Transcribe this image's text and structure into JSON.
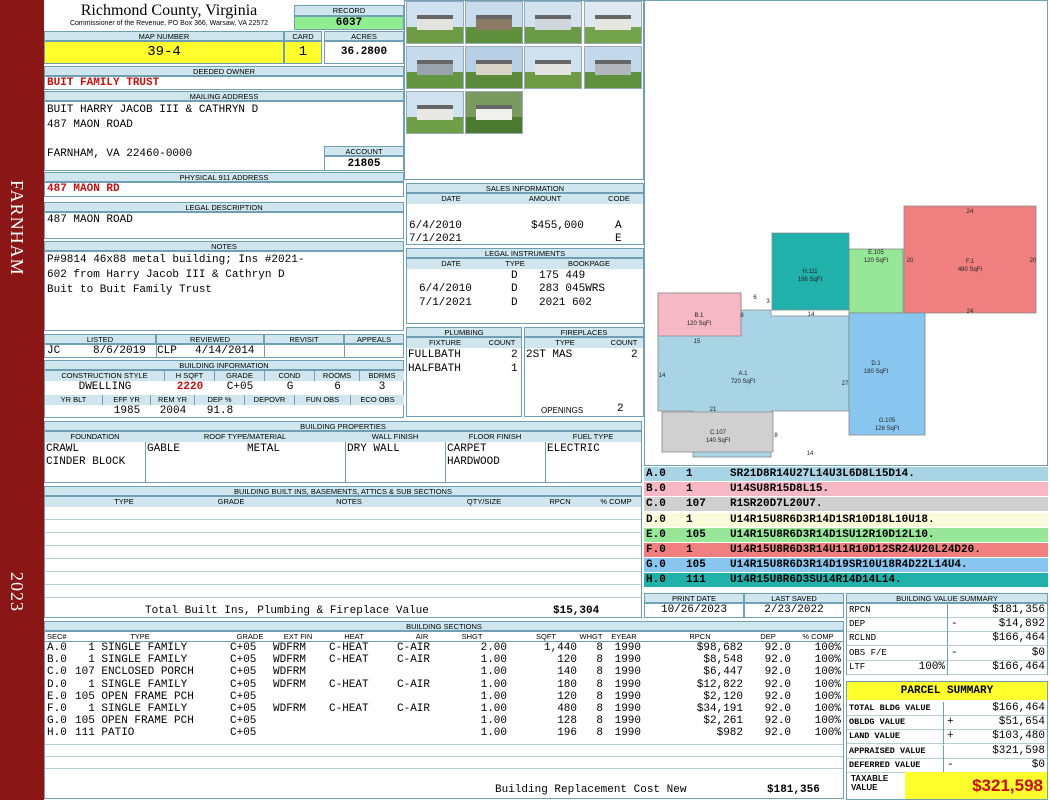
{
  "sidebar": {
    "town": "FARNHAM",
    "year": "2023"
  },
  "county": {
    "title": "Richmond County, Virginia",
    "subtitle": "Commissioner of the Revenue, PO Box 366, Warsaw, VA 22572"
  },
  "record": {
    "label": "RECORD",
    "value": "6037"
  },
  "map": {
    "label": "MAP NUMBER",
    "value": "39-4",
    "card_label": "CARD",
    "card": "1",
    "acres_label": "ACRES",
    "acres": "36.2800"
  },
  "owner": {
    "label": "DEEDED OWNER",
    "value": "BUIT FAMILY TRUST"
  },
  "mailing": {
    "label": "MAILING ADDRESS",
    "line1": "BUIT HARRY JACOB III & CATHRYN D",
    "line2": "487 MAON ROAD",
    "line3": "FARNHAM, VA 22460-0000"
  },
  "account": {
    "label": "ACCOUNT",
    "value": "21805"
  },
  "physical": {
    "label": "PHYSICAL 911 ADDRESS",
    "value": "487 MAON RD"
  },
  "legal": {
    "label": "LEGAL DESCRIPTION",
    "value": "487 MAON ROAD"
  },
  "notes": {
    "label": "NOTES",
    "line1": "P#9814 46x88 metal building; Ins #2021-",
    "line2": "602 from Harry Jacob III & Cathryn D",
    "line3": "Buit to Buit Family Trust"
  },
  "review": {
    "listed_label": "LISTED",
    "listed_by": "JC",
    "listed_date": "8/6/2019",
    "reviewed_label": "REVIEWED",
    "reviewed_by": "CLP",
    "reviewed_date": "4/14/2014",
    "revisit_label": "REVISIT",
    "appeals_label": "APPEALS"
  },
  "building_info": {
    "label": "BUILDING INFORMATION",
    "h1": "CONSTRUCTION STYLE",
    "h2": "H SQFT",
    "h3": "GRADE",
    "h4": "COND",
    "h5": "ROOMS",
    "h6": "BDRMS",
    "style": "DWELLING",
    "sqft": "2220",
    "grade": "C+05",
    "cond": "G",
    "rooms": "6",
    "bdrms": "3",
    "h7": "YR BLT",
    "h8": "EFF YR",
    "h9": "REM YR",
    "h10": "DEP %",
    "h11": "DEPOVR",
    "h12": "FUN OBS",
    "h13": "ECO OBS",
    "eff_yr": "1985",
    "rem_yr": "2004",
    "dep": "91.8"
  },
  "sales": {
    "label": "SALES INFORMATION",
    "h_date": "DATE",
    "h_amount": "AMOUNT",
    "h_code": "CODE",
    "rows": [
      {
        "date": "6/4/2010",
        "amount": "$455,000",
        "code": "A"
      },
      {
        "date": "7/1/2021",
        "amount": "",
        "code": "E"
      }
    ]
  },
  "legal_instruments": {
    "label": "LEGAL INSTRUMENTS",
    "h_date": "DATE",
    "h_type": "TYPE",
    "h_book": "BOOKPAGE",
    "rows": [
      {
        "date": "",
        "type": "D",
        "book": "175 449"
      },
      {
        "date": "6/4/2010",
        "type": "D",
        "book": "283 045WRS"
      },
      {
        "date": "7/1/2021",
        "type": "D",
        "book": "2021 602"
      }
    ]
  },
  "plumbing": {
    "label": "PLUMBING",
    "h_fixture": "FIXTURE",
    "h_count": "COUNT",
    "rows": [
      {
        "fixture": "FULLBATH",
        "count": "2"
      },
      {
        "fixture": "HALFBATH",
        "count": "1"
      }
    ]
  },
  "fireplaces": {
    "label": "FIREPLACES",
    "h_type": "TYPE",
    "h_count": "COUNT",
    "rows": [
      {
        "type": "2ST MAS",
        "count": "2"
      }
    ],
    "openings_label": "OPENINGS",
    "openings": "2"
  },
  "properties": {
    "label": "BUILDING PROPERTIES",
    "h_found": "FOUNDATION",
    "h_roof": "ROOF TYPE/MATERIAL",
    "h_wall": "WALL FINISH",
    "h_floor": "FLOOR FINISH",
    "h_fuel": "FUEL TYPE",
    "found1": "CRAWL",
    "found2": "CINDER BLOCK",
    "roof_type": "GABLE",
    "roof_mat": "METAL",
    "wall": "DRY WALL",
    "floor1": "CARPET",
    "floor2": "HARDWOOD",
    "fuel": "ELECTRIC"
  },
  "builtins": {
    "label": "BUILDING BUILT INS, BASEMENTS, ATTICS & SUB SECTIONS",
    "h_type": "TYPE",
    "h_grade": "GRADE",
    "h_notes": "NOTES",
    "h_qty": "QTY/SIZE",
    "h_rpcn": "RPCN",
    "h_comp": "% COMP",
    "total_label": "Total Built Ins, Plumbing & Fireplace Value",
    "total": "$15,304"
  },
  "dates": {
    "print_label": "PRINT DATE",
    "print": "10/26/2023",
    "saved_label": "LAST SAVED",
    "saved": "2/23/2022"
  },
  "sections": {
    "label": "BUILDING SECTIONS",
    "headers": [
      "SEC#",
      "TYPE",
      "GRADE",
      "EXT FIN",
      "HEAT",
      "AIR",
      "SHGT",
      "SQFT",
      "WHGT",
      "EYEAR",
      "RPCN",
      "DEP",
      "% COMP"
    ],
    "rows": [
      {
        "sec": "A.0",
        "num": "1",
        "type": "SINGLE FAMILY",
        "grade": "C+05",
        "ext": "WDFRM",
        "heat": "C-HEAT",
        "air": "C-AIR",
        "shgt": "2.00",
        "sqft": "1,440",
        "whgt": "8",
        "eyear": "1990",
        "rpcn": "$98,682",
        "dep": "92.0",
        "comp": "100%"
      },
      {
        "sec": "B.0",
        "num": "1",
        "type": "SINGLE FAMILY",
        "grade": "C+05",
        "ext": "WDFRM",
        "heat": "C-HEAT",
        "air": "C-AIR",
        "shgt": "1.00",
        "sqft": "120",
        "whgt": "8",
        "eyear": "1990",
        "rpcn": "$8,548",
        "dep": "92.0",
        "comp": "100%"
      },
      {
        "sec": "C.0",
        "num": "107",
        "type": "ENCLOSED PORCH",
        "grade": "C+05",
        "ext": "WDFRM",
        "heat": "",
        "air": "",
        "shgt": "1.00",
        "sqft": "140",
        "whgt": "8",
        "eyear": "1990",
        "rpcn": "$6,447",
        "dep": "92.0",
        "comp": "100%"
      },
      {
        "sec": "D.0",
        "num": "1",
        "type": "SINGLE FAMILY",
        "grade": "C+05",
        "ext": "WDFRM",
        "heat": "C-HEAT",
        "air": "C-AIR",
        "shgt": "1.00",
        "sqft": "180",
        "whgt": "8",
        "eyear": "1990",
        "rpcn": "$12,822",
        "dep": "92.0",
        "comp": "100%"
      },
      {
        "sec": "E.0",
        "num": "105",
        "type": "OPEN FRAME PCH",
        "grade": "C+05",
        "ext": "",
        "heat": "",
        "air": "",
        "shgt": "1.00",
        "sqft": "120",
        "whgt": "8",
        "eyear": "1990",
        "rpcn": "$2,120",
        "dep": "92.0",
        "comp": "100%"
      },
      {
        "sec": "F.0",
        "num": "1",
        "type": "SINGLE FAMILY",
        "grade": "C+05",
        "ext": "WDFRM",
        "heat": "C-HEAT",
        "air": "C-AIR",
        "shgt": "1.00",
        "sqft": "480",
        "whgt": "8",
        "eyear": "1990",
        "rpcn": "$34,191",
        "dep": "92.0",
        "comp": "100%"
      },
      {
        "sec": "G.0",
        "num": "105",
        "type": "OPEN FRAME PCH",
        "grade": "C+05",
        "ext": "",
        "heat": "",
        "air": "",
        "shgt": "1.00",
        "sqft": "128",
        "whgt": "8",
        "eyear": "1990",
        "rpcn": "$2,261",
        "dep": "92.0",
        "comp": "100%"
      },
      {
        "sec": "H.0",
        "num": "111",
        "type": "PATIO",
        "grade": "C+05",
        "ext": "",
        "heat": "",
        "air": "",
        "shgt": "1.00",
        "sqft": "196",
        "whgt": "8",
        "eyear": "1990",
        "rpcn": "$982",
        "dep": "92.0",
        "comp": "100%"
      }
    ],
    "total_label": "Building Replacement Cost New",
    "total": "$181,356"
  },
  "sketch": {
    "labels": [
      {
        "id": "A.1",
        "area": "720 SqFt",
        "color": "#a8d4e6"
      },
      {
        "id": "B.1",
        "area": "120 SqFt",
        "color": "#f5b8c4"
      },
      {
        "id": "C.107",
        "area": "140 SqFt",
        "color": "#d0d0d0"
      },
      {
        "id": "D.1",
        "area": "180 SqFt",
        "color": "#fbfbdc"
      },
      {
        "id": "E.105",
        "area": "120 SqFt",
        "color": "#98e698"
      },
      {
        "id": "F.1",
        "area": "480 SqFt",
        "color": "#f08080"
      },
      {
        "id": "G.105",
        "area": "128 SqFt",
        "color": "#88c6f0"
      },
      {
        "id": "H.111",
        "area": "196 SqFt",
        "color": "#20b2aa"
      }
    ],
    "dims": [
      "24",
      "20",
      "20",
      "24",
      "6",
      "3",
      "8",
      "14",
      "15",
      "14",
      "27",
      "21",
      "8",
      "14"
    ]
  },
  "traverse": [
    {
      "sec": "A.0",
      "num": "1",
      "code": "SR21D8R14U27L14U3L6D8L15D14.",
      "color": "#a8d4e6"
    },
    {
      "sec": "B.0",
      "num": "1",
      "code": "U14SU8R15D8L15.",
      "color": "#f5b8c4"
    },
    {
      "sec": "C.0",
      "num": "107",
      "code": "R1SR20D7L20U7.",
      "color": "#d0d0d0"
    },
    {
      "sec": "D.0",
      "num": "1",
      "code": "U14R15U8R6D3R14D1SR10D18L10U18.",
      "color": "#fbfbdc"
    },
    {
      "sec": "E.0",
      "num": "105",
      "code": "U14R15U8R6D3R14D1SU12R10D12L10.",
      "color": "#98e698"
    },
    {
      "sec": "F.0",
      "num": "1",
      "code": "U14R15U8R6D3R14U11R10D12SR24U20L24D20.",
      "color": "#f08080"
    },
    {
      "sec": "G.0",
      "num": "105",
      "code": "U14R15U8R6D3R14D19SR10U18R4D22L14U4.",
      "color": "#88c6f0"
    },
    {
      "sec": "H.0",
      "num": "111",
      "code": "U14R15U8R6D3SU14R14D14L14.",
      "color": "#20b2aa"
    }
  ],
  "value_summary": {
    "label": "BUILDING VALUE SUMMARY",
    "rows": [
      {
        "label": "RPCN",
        "sign": "",
        "pct": "",
        "value": "$181,356"
      },
      {
        "label": "DEP",
        "sign": "-",
        "pct": "",
        "value": "$14,892"
      },
      {
        "label": "RCLND",
        "sign": "",
        "pct": "",
        "value": "$166,464"
      },
      {
        "label": "OBS F/E",
        "sign": "-",
        "pct": "",
        "value": "$0"
      },
      {
        "label": "LTF",
        "sign": "",
        "pct": "100%",
        "value": "$166,464"
      }
    ]
  },
  "parcel": {
    "label": "PARCEL SUMMARY",
    "rows": [
      {
        "label": "TOTAL BLDG VALUE",
        "sign": "",
        "value": "$166,464"
      },
      {
        "label": "OBLDG VALUE",
        "sign": "+",
        "value": "$51,654"
      },
      {
        "label": "LAND VALUE",
        "sign": "+",
        "value": "$103,480"
      },
      {
        "label": "APPRAISED VALUE",
        "sign": "",
        "value": "$321,598"
      },
      {
        "label": "DEFERRED VALUE",
        "sign": "-",
        "value": "$0"
      }
    ],
    "taxable_label1": "TAXABLE",
    "taxable_label2": "VALUE",
    "taxable": "$321,598"
  },
  "photos": [
    {
      "sky": "#cfe0ee",
      "ground": "#6c9a45",
      "subject": "#e2e2de"
    },
    {
      "sky": "#c8dcec",
      "ground": "#5e8f3d",
      "subject": "#8a7a66"
    },
    {
      "sky": "#d2e2ee",
      "ground": "#6a9948",
      "subject": "#cfd6dc"
    },
    {
      "sky": "#dde8f0",
      "ground": "#74a34e",
      "subject": "#e6e6e0"
    },
    {
      "sky": "#c6dbeb",
      "ground": "#649642",
      "subject": "#9aa3ab"
    },
    {
      "sky": "#b8d0e6",
      "ground": "#5a8a3a",
      "subject": "#d8d4c8"
    },
    {
      "sky": "#cfe0ee",
      "ground": "#6c9a45",
      "subject": "#e4e4e0"
    },
    {
      "sky": "#c4daec",
      "ground": "#5f903e",
      "subject": "#b4b8bc"
    },
    {
      "sky": "#d0e2ee",
      "ground": "#6e9e48",
      "subject": "#e8e8e4"
    },
    {
      "sky": "#7a9a60",
      "ground": "#4c7a30",
      "subject": "#f0f0ec"
    }
  ]
}
